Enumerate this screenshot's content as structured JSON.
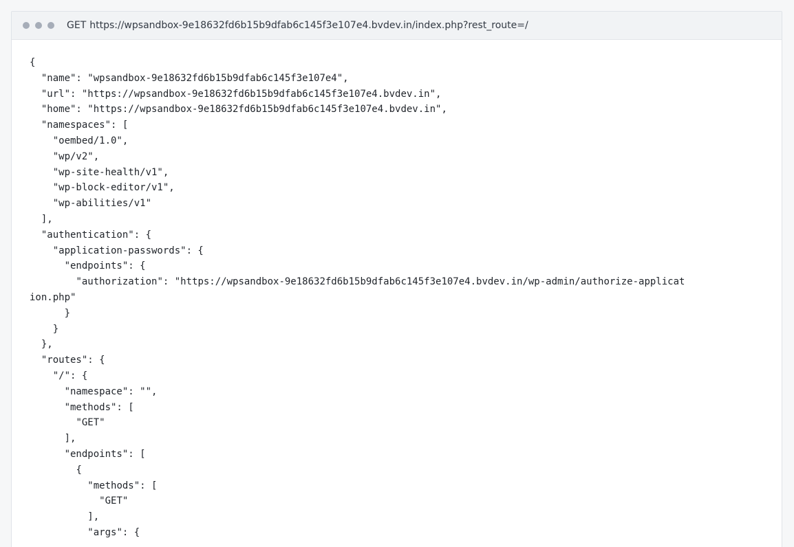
{
  "titlebar": {
    "method": "GET",
    "url": "https://wpsandbox-9e18632fd6b15b9dfab6c145f3e107e4.bvdev.in/index.php?rest_route=/"
  },
  "response_body": "{\n  \"name\": \"wpsandbox-9e18632fd6b15b9dfab6c145f3e107e4\",\n  \"url\": \"https://wpsandbox-9e18632fd6b15b9dfab6c145f3e107e4.bvdev.in\",\n  \"home\": \"https://wpsandbox-9e18632fd6b15b9dfab6c145f3e107e4.bvdev.in\",\n  \"namespaces\": [\n    \"oembed/1.0\",\n    \"wp/v2\",\n    \"wp-site-health/v1\",\n    \"wp-block-editor/v1\",\n    \"wp-abilities/v1\"\n  ],\n  \"authentication\": {\n    \"application-passwords\": {\n      \"endpoints\": {\n        \"authorization\": \"https://wpsandbox-9e18632fd6b15b9dfab6c145f3e107e4.bvdev.in/wp-admin/authorize-application.php\"\n      }\n    }\n  },\n  \"routes\": {\n    \"/\": {\n      \"namespace\": \"\",\n      \"methods\": [\n        \"GET\"\n      ],\n      \"endpoints\": [\n        {\n          \"methods\": [\n            \"GET\"\n          ],\n          \"args\": {"
}
